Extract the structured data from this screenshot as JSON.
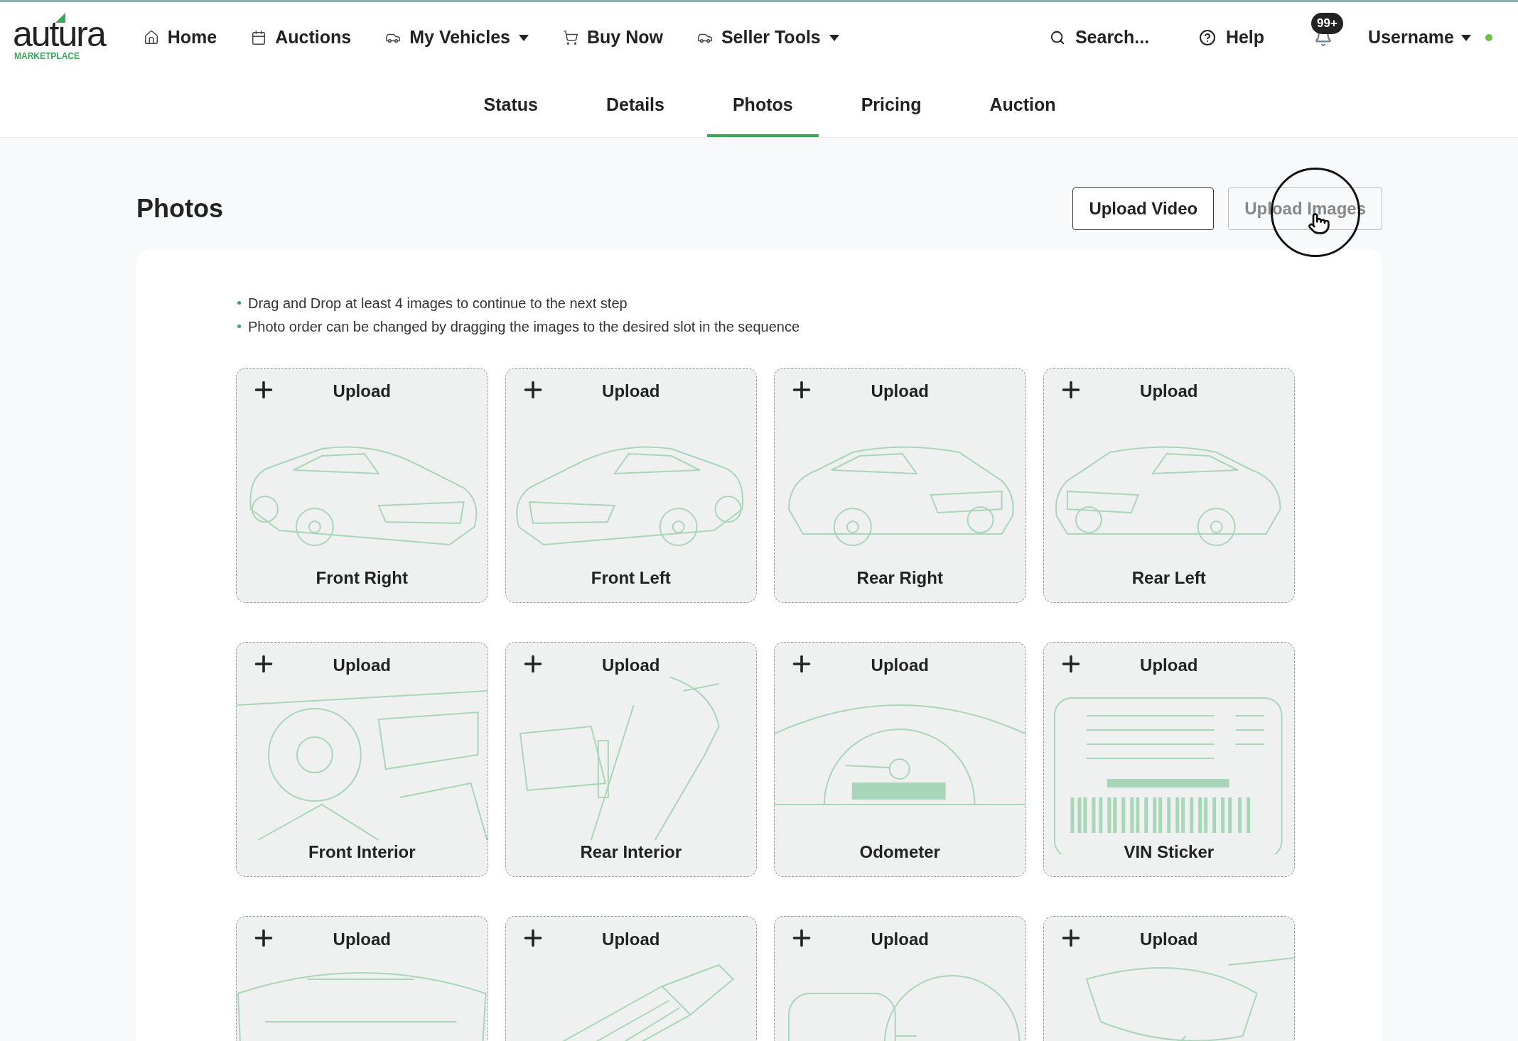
{
  "brand": {
    "name": "autura",
    "tagline": "MARKETPLACE"
  },
  "nav": [
    {
      "label": "Home",
      "kind": "home",
      "dropdown": false
    },
    {
      "label": "Auctions",
      "kind": "calendar",
      "dropdown": false
    },
    {
      "label": "My Vehicles",
      "kind": "car",
      "dropdown": true
    },
    {
      "label": "Buy Now",
      "kind": "cart",
      "dropdown": false
    },
    {
      "label": "Seller Tools",
      "kind": "car",
      "dropdown": true
    }
  ],
  "search": {
    "placeholder": "Search..."
  },
  "help": "Help",
  "notifications": {
    "badge": "99+"
  },
  "user": {
    "name": "Username",
    "online": true
  },
  "tabs": [
    {
      "label": "Status",
      "selected": false
    },
    {
      "label": "Details",
      "selected": false
    },
    {
      "label": "Photos",
      "selected": true
    },
    {
      "label": "Pricing",
      "selected": false
    },
    {
      "label": "Auction",
      "selected": false
    }
  ],
  "page_title": "Photos",
  "buttons": [
    {
      "label": "Upload Video",
      "disabled": false
    },
    {
      "label": "Upload Images",
      "disabled": true
    }
  ],
  "instructions": [
    "Drag and Drop at least 4 images to continue to the next step",
    "Photo order can be changed by dragging the images to the desired slot in the sequence"
  ],
  "slots": [
    {
      "action": "Upload",
      "label": "Front Right",
      "kind": "car-front-right"
    },
    {
      "action": "Upload",
      "label": "Front Left",
      "kind": "car-front-left"
    },
    {
      "action": "Upload",
      "label": "Rear Right",
      "kind": "car-rear-right"
    },
    {
      "action": "Upload",
      "label": "Rear Left",
      "kind": "car-rear-left"
    },
    {
      "action": "Upload",
      "label": "Front Interior",
      "kind": "interior"
    },
    {
      "action": "Upload",
      "label": "Rear Interior",
      "kind": "seat"
    },
    {
      "action": "Upload",
      "label": "Odometer",
      "kind": "gauge"
    },
    {
      "action": "Upload",
      "label": "VIN Sticker",
      "kind": "sticker"
    },
    {
      "action": "Upload",
      "kind": "engine"
    },
    {
      "action": "Upload",
      "kind": "part"
    },
    {
      "action": "Upload",
      "kind": "key"
    },
    {
      "action": "Upload",
      "kind": "trunk"
    }
  ]
}
